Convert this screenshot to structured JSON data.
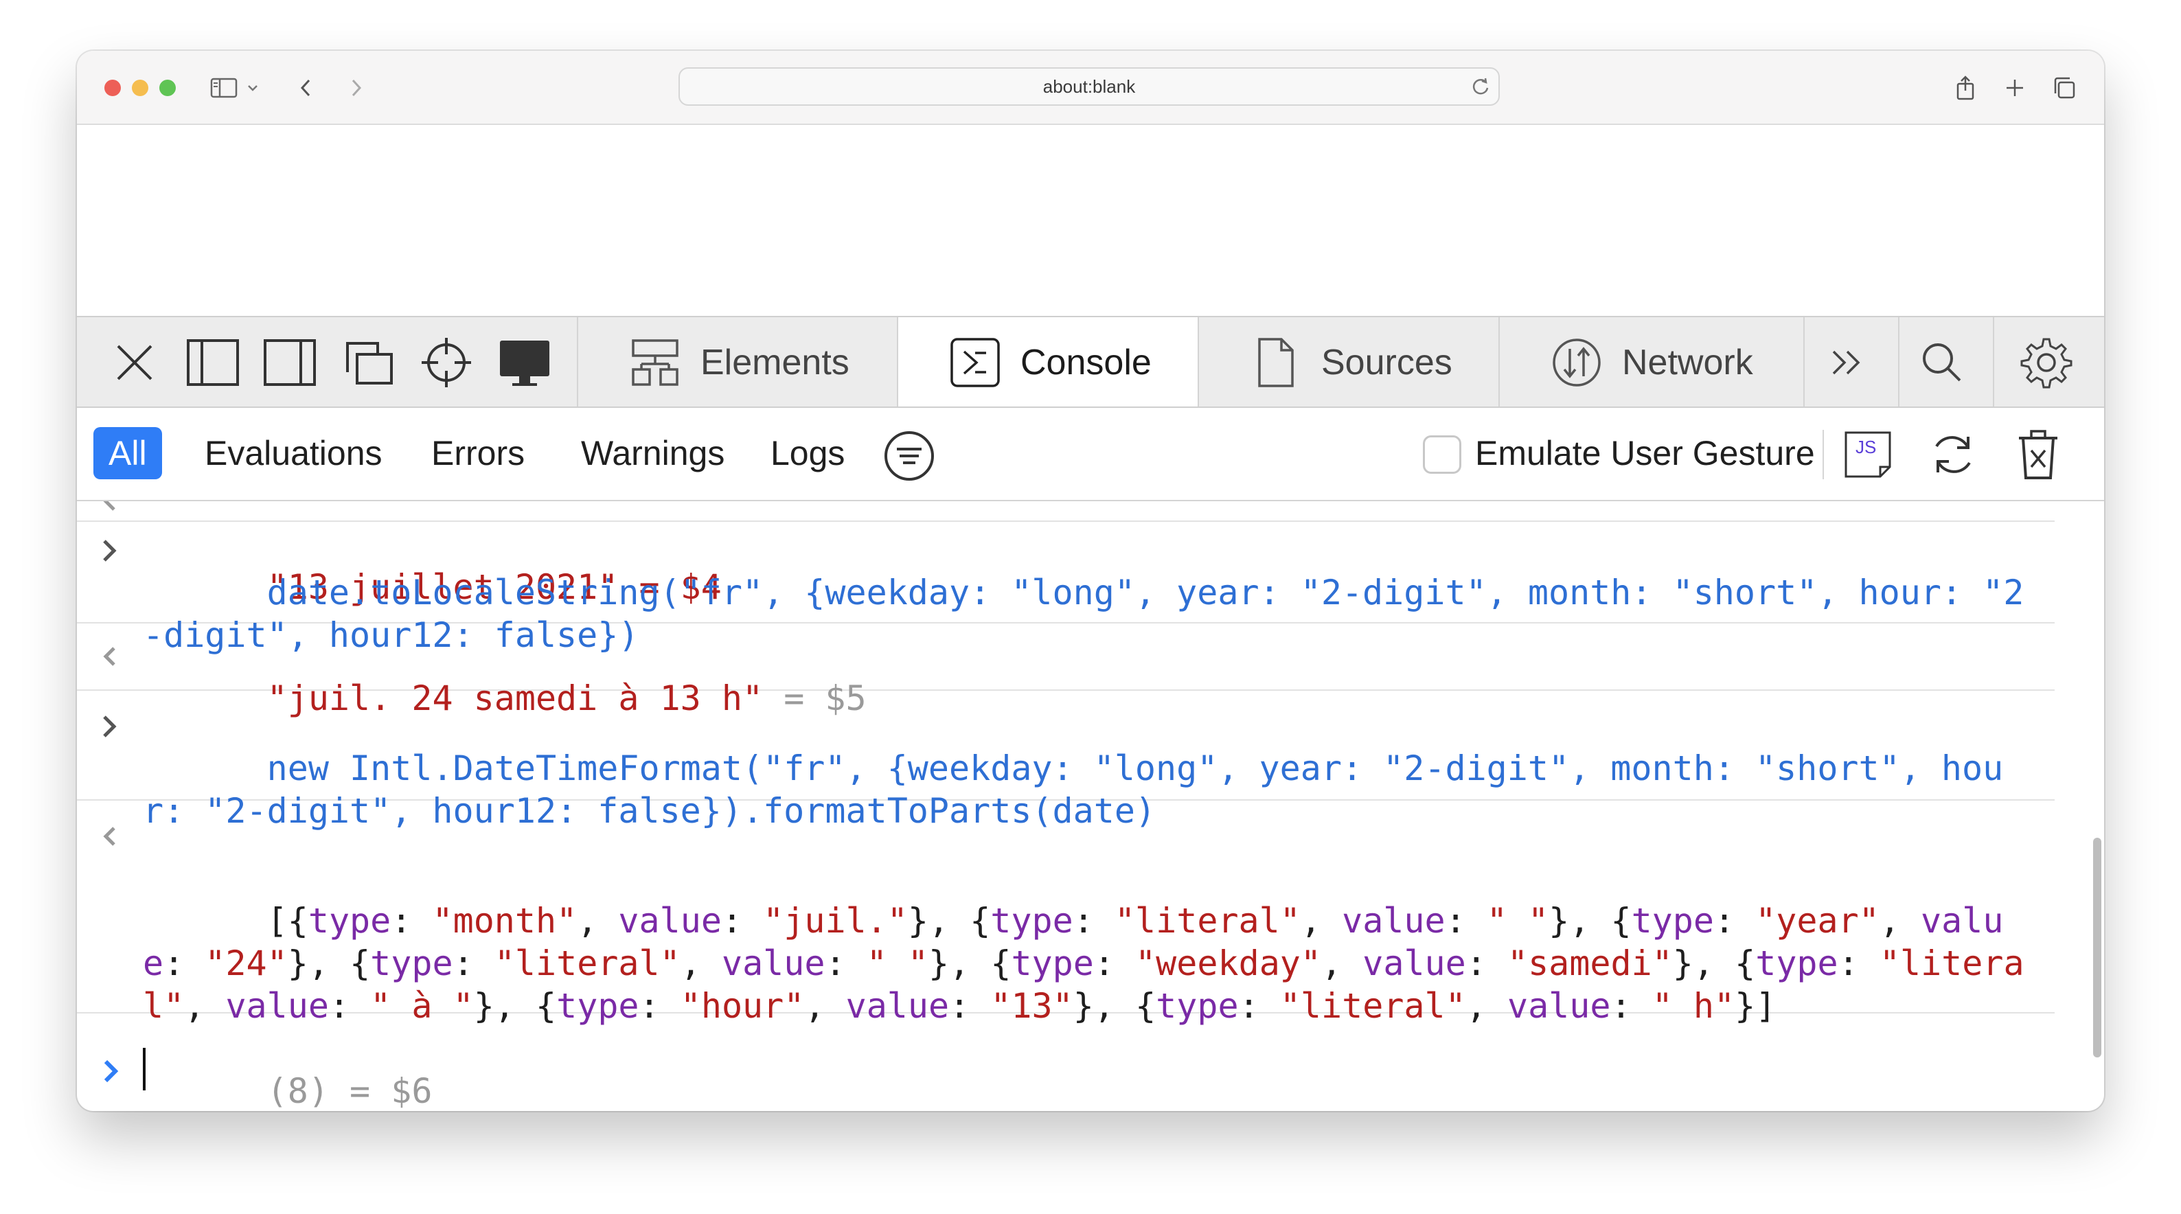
{
  "browser": {
    "url": "about:blank",
    "icons": [
      "sidebar-icon",
      "chevron-down-icon",
      "back-icon",
      "forward-icon",
      "reload-icon",
      "share-icon",
      "new-tab-icon",
      "tabs-overview-icon"
    ]
  },
  "devtools": {
    "tabs": [
      {
        "label": "Elements",
        "icon": "elements-icon"
      },
      {
        "label": "Console",
        "icon": "console-icon",
        "active": true
      },
      {
        "label": "Sources",
        "icon": "sources-icon"
      },
      {
        "label": "Network",
        "icon": "network-icon"
      }
    ]
  },
  "filters": {
    "all": "All",
    "evaluations": "Evaluations",
    "errors": "Errors",
    "warnings": "Warnings",
    "logs": "Logs",
    "emulate_gesture": "Emulate User Gesture"
  },
  "js_badge": "JS",
  "console": {
    "clipped_output": "\"13 juillet 2021\" = $4",
    "entries": [
      {
        "type": "input",
        "text": "date.toLocaleString(\"fr\", {weekday: \"long\", year: \"2-digit\", month: \"short\", hour: \"2-digit\", hour12: false})"
      },
      {
        "type": "output",
        "value": "\"juil. 24 samedi à 13 h\"",
        "suffix": " = $5"
      },
      {
        "type": "input",
        "text": "new Intl.DateTimeFormat(\"fr\", {weekday: \"long\", year: \"2-digit\", month: \"short\", hour: \"2-digit\", hour12: false}).formatToParts(date)"
      },
      {
        "type": "output-array",
        "parts": [
          {
            "type": "month",
            "value": "juil."
          },
          {
            "type": "literal",
            "value": " "
          },
          {
            "type": "year",
            "value": "24"
          },
          {
            "type": "literal",
            "value": " "
          },
          {
            "type": "weekday",
            "value": "samedi"
          },
          {
            "type": "literal",
            "value": " à "
          },
          {
            "type": "hour",
            "value": "13"
          },
          {
            "type": "literal",
            "value": " h"
          }
        ],
        "suffix": "(8) = $6"
      }
    ]
  },
  "colors": {
    "accent": "#2f7df6",
    "string": "#b3201e",
    "key": "#7a2aa6",
    "input": "#2e6fd4"
  }
}
